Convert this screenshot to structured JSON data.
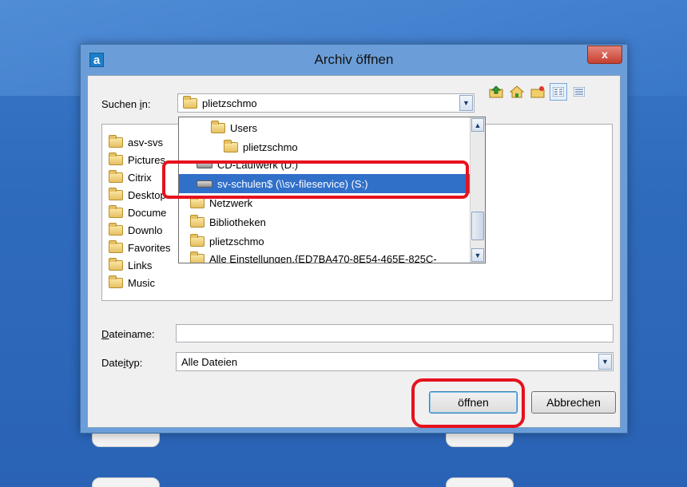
{
  "window": {
    "title": "Archiv öffnen",
    "icon_letter": "a",
    "close_label": "x"
  },
  "lookin": {
    "label_pre": "Suchen ",
    "label_u": "i",
    "label_post": "n:",
    "value": "plietzschmo"
  },
  "toolbar": {
    "icons": [
      "folder-up-icon",
      "home-icon",
      "new-folder-icon",
      "list-view-icon",
      "details-view-icon"
    ]
  },
  "files": [
    {
      "name": "asv-svs"
    },
    {
      "name": "Pictures"
    },
    {
      "name": "Citrix"
    },
    {
      "name": "Desktop"
    },
    {
      "name": "Docume"
    },
    {
      "name": "Downlo"
    },
    {
      "name": "Favorites"
    },
    {
      "name": "Links"
    },
    {
      "name": "Music"
    }
  ],
  "dropdown": {
    "items": [
      {
        "name": "Users",
        "kind": "folder",
        "indent": 2
      },
      {
        "name": "plietzschmo",
        "kind": "folder",
        "indent": 3
      },
      {
        "name": "CD-Laufwerk (D:)",
        "kind": "drive",
        "indent": 1
      },
      {
        "name": "sv-schulen$ (\\\\sv-fileservice) (S:)",
        "kind": "drive",
        "indent": 1,
        "selected": true
      },
      {
        "name": "Netzwerk",
        "kind": "folder",
        "indent": 0
      },
      {
        "name": "Bibliotheken",
        "kind": "folder",
        "indent": 0
      },
      {
        "name": "plietzschmo",
        "kind": "folder",
        "indent": 0
      },
      {
        "name": "Alle Einstellungen.{ED7BA470-8E54-465E-825C-",
        "kind": "folder",
        "indent": 0
      }
    ]
  },
  "filename": {
    "label_u": "D",
    "label_rest": "ateiname:",
    "value": ""
  },
  "filetype": {
    "label_pre": "Date",
    "label_u": "i",
    "label_post": "typ:",
    "value": "Alle Dateien"
  },
  "buttons": {
    "open": "öffnen",
    "cancel": "Abbrechen"
  },
  "colors": {
    "selection": "#3170c9",
    "highlight": "#e6121e"
  }
}
